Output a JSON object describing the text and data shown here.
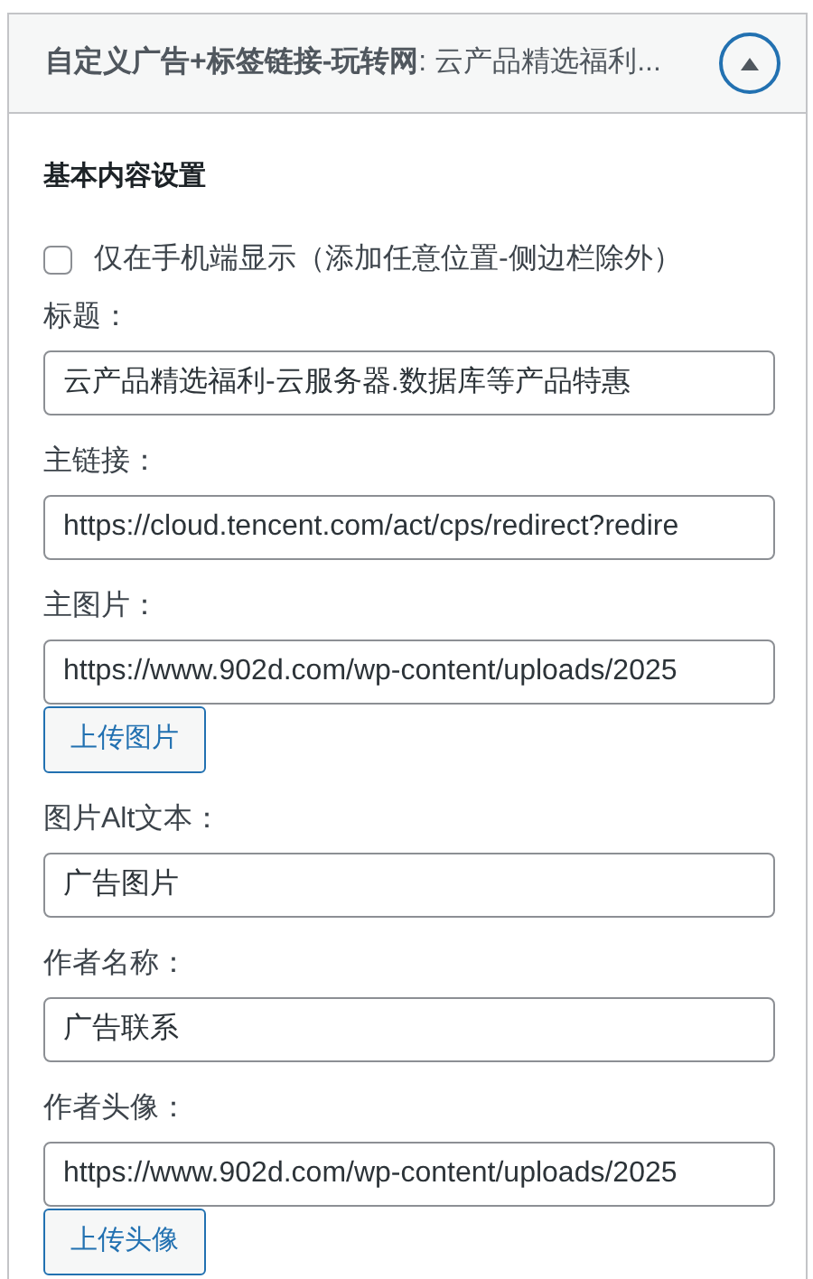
{
  "panel": {
    "title": "**自定义广告+标签链接-玩转网**: 云产品精选福利...",
    "expanded": true
  },
  "section_title": "基本内容设置",
  "mobile_only": {
    "label": "仅在手机端显示（添加任意位置-侧边栏除外）",
    "checked": false
  },
  "fields": [
    {
      "label": "标题：",
      "value": "云产品精选福利-云服务器.数据库等产品特惠"
    },
    {
      "label": "主链接：",
      "value": "https://cloud.tencent.com/act/cps/redirect?redire"
    },
    {
      "label": "主图片：",
      "value": "https://www.902d.com/wp-content/uploads/2025",
      "button": "上传图片"
    },
    {
      "label": "图片Alt文本：",
      "value": "广告图片"
    },
    {
      "label": "作者名称：",
      "value": "广告联系"
    },
    {
      "label": "作者头像：",
      "value": "https://www.902d.com/wp-content/uploads/2025",
      "button": "上传头像"
    }
  ]
}
